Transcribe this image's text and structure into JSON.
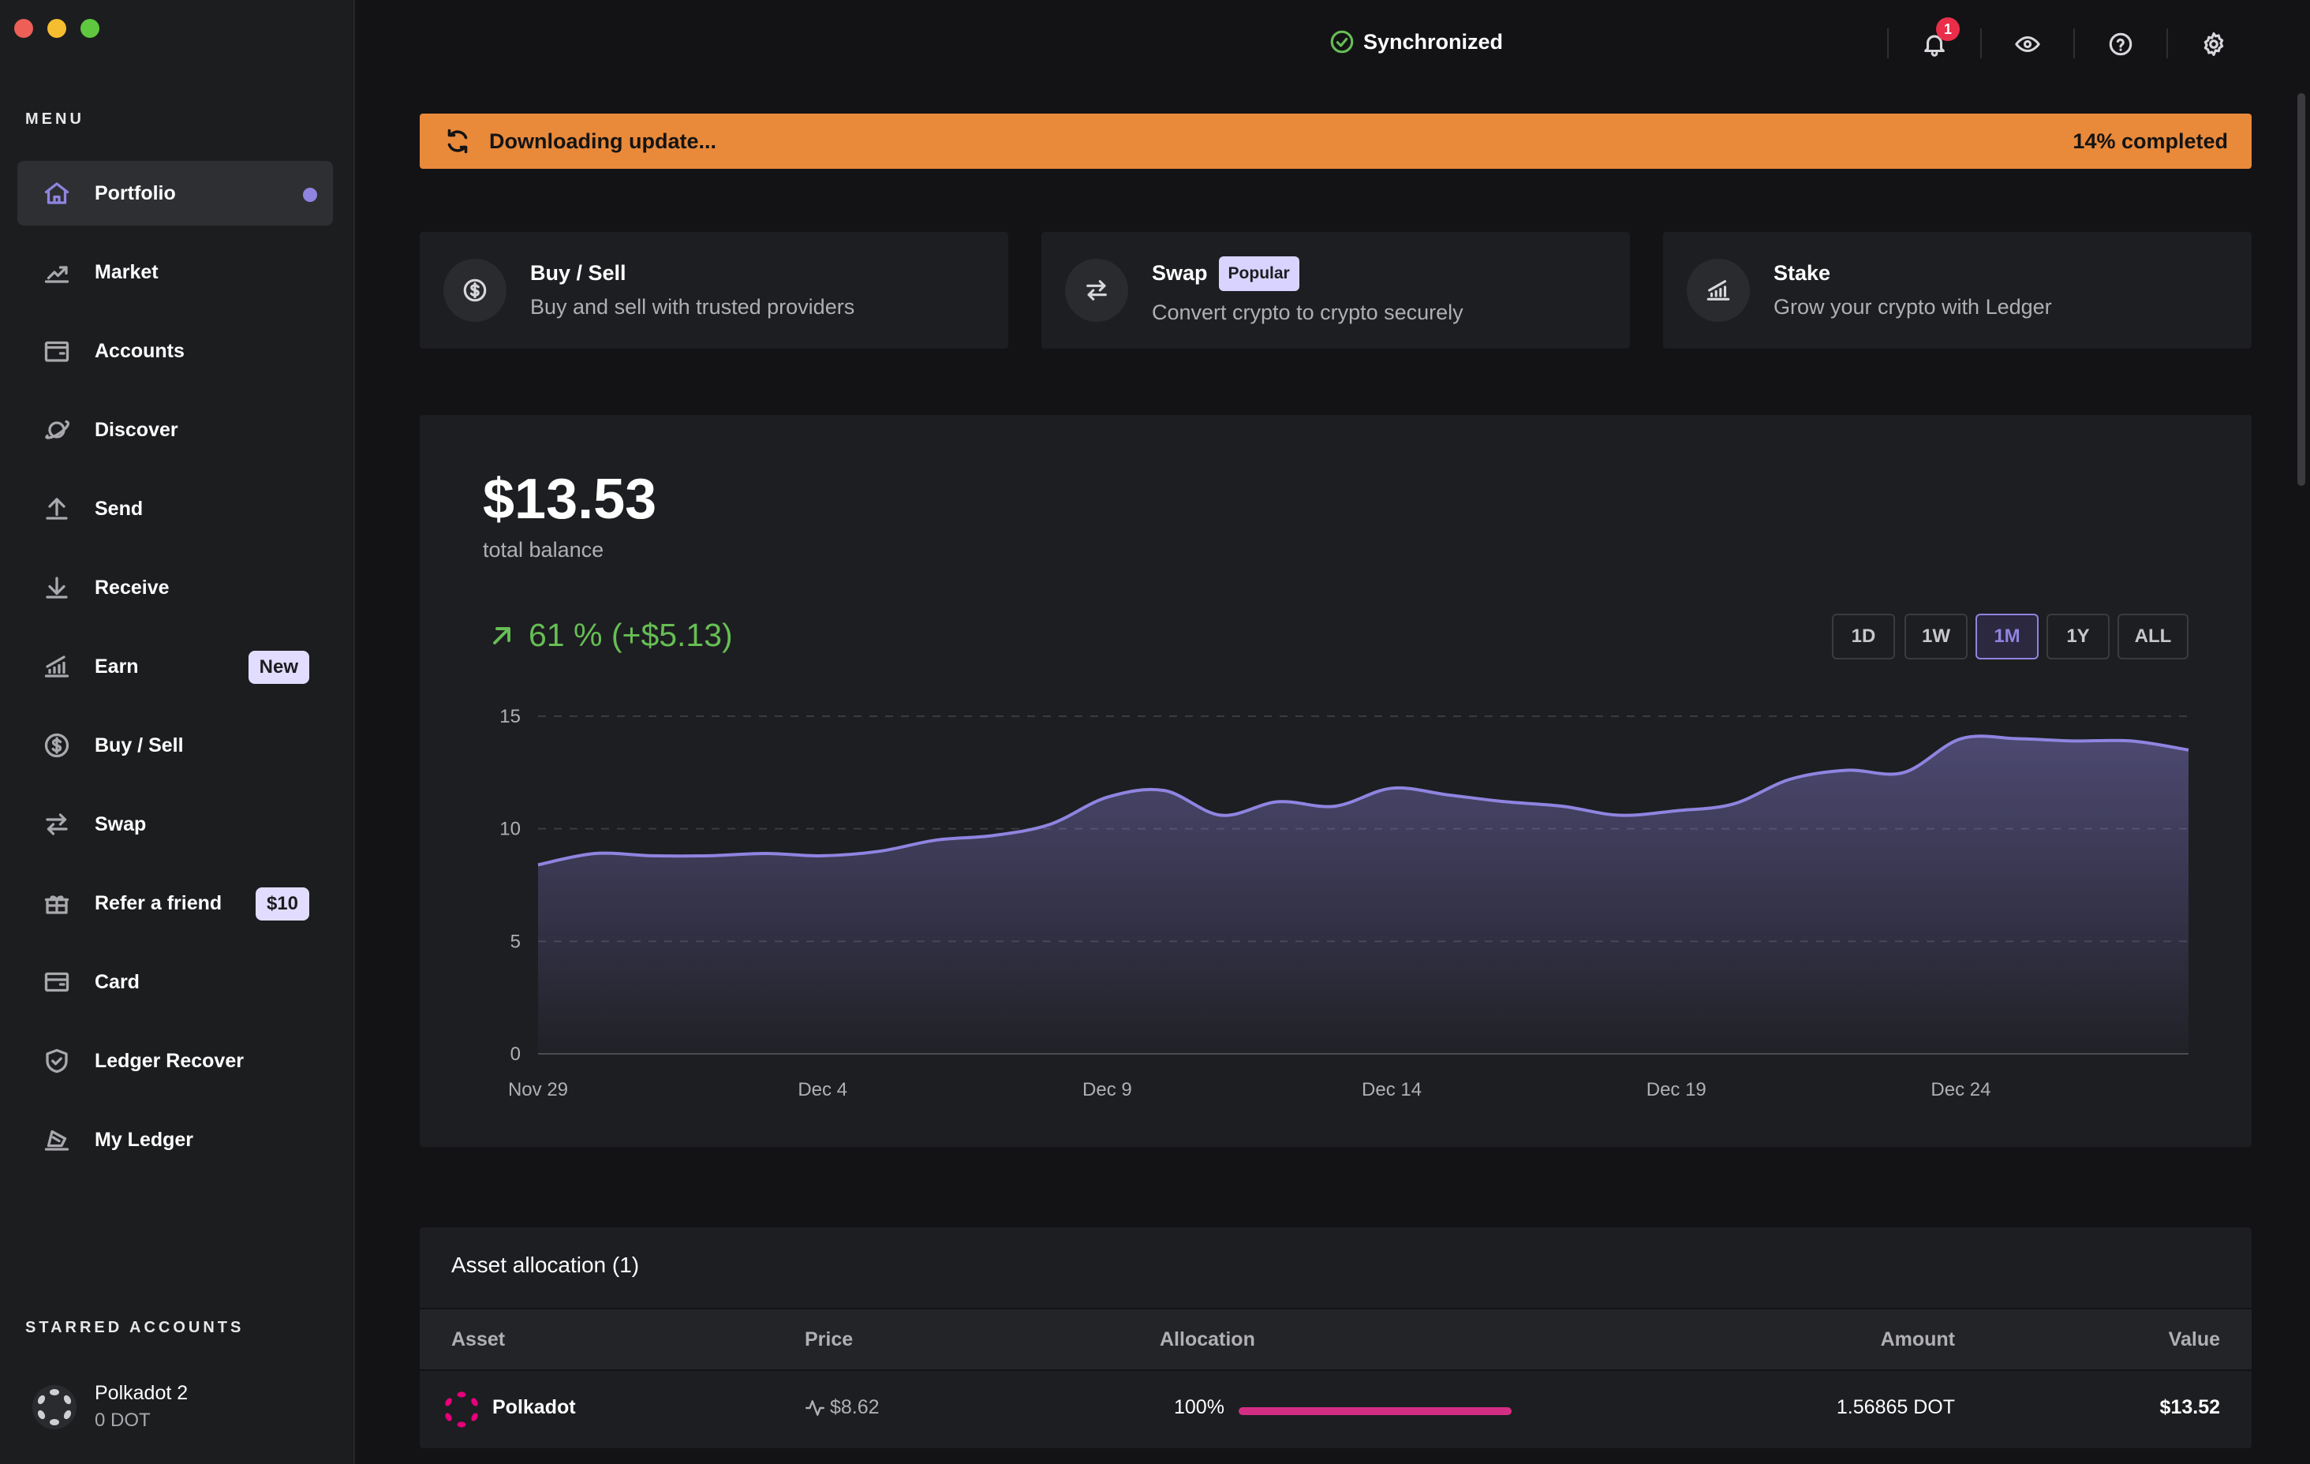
{
  "window": {
    "traffic_lights": [
      "#ed5f57",
      "#f5bd2f",
      "#5fc83f"
    ]
  },
  "sidebar": {
    "menu_title": "MENU",
    "items": [
      {
        "label": "Portfolio",
        "icon": "home-icon",
        "active": true
      },
      {
        "label": "Market",
        "icon": "chart-up-icon"
      },
      {
        "label": "Accounts",
        "icon": "wallet-icon"
      },
      {
        "label": "Discover",
        "icon": "planet-icon"
      },
      {
        "label": "Send",
        "icon": "upload-icon"
      },
      {
        "label": "Receive",
        "icon": "download-icon"
      },
      {
        "label": "Earn",
        "icon": "bars-up-icon",
        "badge": "New"
      },
      {
        "label": "Buy / Sell",
        "icon": "dollar-coin-icon"
      },
      {
        "label": "Swap",
        "icon": "swap-icon"
      },
      {
        "label": "Refer a friend",
        "icon": "gift-icon",
        "badge": "$10"
      },
      {
        "label": "Card",
        "icon": "card-icon"
      },
      {
        "label": "Ledger Recover",
        "icon": "shield-icon"
      },
      {
        "label": "My Ledger",
        "icon": "ledger-device-icon"
      }
    ],
    "starred_title": "STARRED ACCOUNTS",
    "starred": [
      {
        "name": "Polkadot 2",
        "balance": "0 DOT"
      }
    ]
  },
  "topbar": {
    "sync_label": "Synchronized",
    "notification_count": "1"
  },
  "banner": {
    "message": "Downloading update...",
    "progress_text": "14% completed",
    "progress": 0.14
  },
  "actions": [
    {
      "title": "Buy / Sell",
      "subtitle": "Buy and sell with trusted providers",
      "icon": "dollar-coin-icon"
    },
    {
      "title": "Swap",
      "subtitle": "Convert crypto to crypto securely",
      "icon": "swap-icon",
      "badge": "Popular"
    },
    {
      "title": "Stake",
      "subtitle": "Grow your crypto with Ledger",
      "icon": "bars-up-icon"
    }
  ],
  "portfolio": {
    "balance": "$13.53",
    "balance_label": "total balance",
    "delta": "61 % (+$5.13)",
    "ranges": [
      "1D",
      "1W",
      "1M",
      "1Y",
      "ALL"
    ],
    "active_range": "1M"
  },
  "chart_data": {
    "type": "area",
    "title": "",
    "xlabel": "",
    "ylabel": "",
    "ylim": [
      0,
      15
    ],
    "yticks": [
      0,
      5,
      10,
      15
    ],
    "xticks": [
      "Nov 29",
      "Dec 4",
      "Dec 9",
      "Dec 14",
      "Dec 19",
      "Dec 24"
    ],
    "grid": true,
    "x": [
      "Nov 29",
      "Nov 30",
      "Dec 1",
      "Dec 2",
      "Dec 3",
      "Dec 4",
      "Dec 5",
      "Dec 6",
      "Dec 7",
      "Dec 8",
      "Dec 9",
      "Dec 10",
      "Dec 11",
      "Dec 12",
      "Dec 13",
      "Dec 14",
      "Dec 15",
      "Dec 16",
      "Dec 17",
      "Dec 18",
      "Dec 19",
      "Dec 20",
      "Dec 21",
      "Dec 22",
      "Dec 23",
      "Dec 24",
      "Dec 25",
      "Dec 26",
      "Dec 27",
      "Dec 28"
    ],
    "series": [
      {
        "values": [
          8.4,
          8.9,
          8.8,
          8.8,
          8.9,
          8.8,
          9.0,
          9.5,
          9.7,
          10.2,
          11.4,
          11.7,
          10.6,
          11.2,
          11.0,
          11.8,
          11.5,
          11.2,
          11.0,
          10.6,
          10.8,
          11.1,
          12.2,
          12.6,
          12.5,
          14.0,
          14.0,
          13.9,
          13.9,
          13.5
        ]
      }
    ],
    "color": "#8f84e0"
  },
  "assets": {
    "title": "Asset allocation (1)",
    "columns": [
      "Asset",
      "Price",
      "Allocation",
      "Amount",
      "Value"
    ],
    "rows": [
      {
        "name": "Polkadot",
        "price": "$8.62",
        "allocation": "100%",
        "allocation_fraction": 1.0,
        "amount": "1.56865 DOT",
        "value": "$13.52"
      }
    ]
  }
}
